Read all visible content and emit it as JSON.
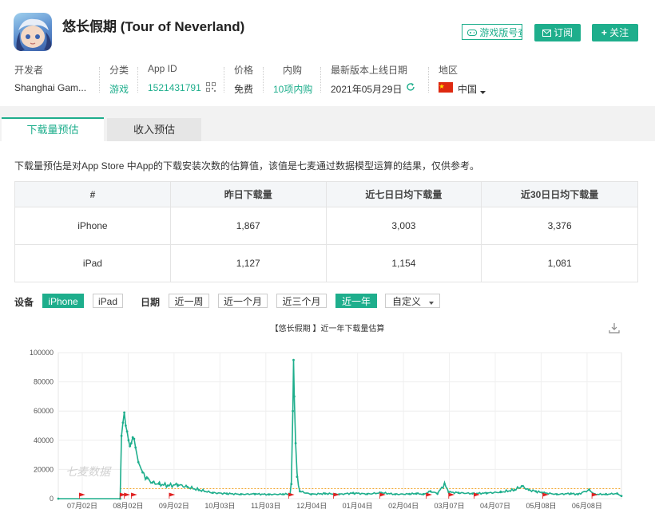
{
  "app": {
    "title": "悠长假期 (Tour of Neverland)",
    "query_button": "游戏版号查询",
    "subscribe_button": "订阅",
    "follow_button": "关注"
  },
  "info": [
    {
      "label": "开发者",
      "value": "Shanghai Gam..."
    },
    {
      "label": "分类",
      "value": "游戏"
    },
    {
      "label": "App ID",
      "value": "1521431791"
    },
    {
      "label": "价格",
      "value": "免费"
    },
    {
      "label": "内购",
      "value": "10项内购"
    },
    {
      "label": "最新版本上线日期",
      "value": "2021年05月29日"
    },
    {
      "label": "地区",
      "value": "中国"
    }
  ],
  "tabs": [
    {
      "label": "下载量预估",
      "active": true
    },
    {
      "label": "收入预估",
      "active": false
    }
  ],
  "description": "下载量预估是对App Store 中App的下载安装次数的估算值，该值是七麦通过数据模型运算的结果，仅供参考。",
  "table": {
    "headers": [
      "#",
      "昨日下载量",
      "近七日日均下载量",
      "近30日日均下载量"
    ],
    "rows": [
      [
        "iPhone",
        "1,867",
        "3,003",
        "3,376"
      ],
      [
        "iPad",
        "1,127",
        "1,154",
        "1,081"
      ]
    ]
  },
  "filters": {
    "device_label": "设备",
    "devices": [
      {
        "label": "iPhone",
        "active": true
      },
      {
        "label": "iPad",
        "active": false
      }
    ],
    "date_label": "日期",
    "ranges": [
      {
        "label": "近一周",
        "active": false
      },
      {
        "label": "近一个月",
        "active": false
      },
      {
        "label": "近三个月",
        "active": false
      },
      {
        "label": "近一年",
        "active": true
      },
      {
        "label": "自定义",
        "active": false
      }
    ]
  },
  "colors": {
    "accent": "#1eae8c",
    "marker": "#e02020",
    "avg_line": "#f0a020"
  },
  "chart_data": {
    "type": "line",
    "title": "【悠长假期 】近一年下载量估算",
    "watermark": "七麦数据",
    "ylim": [
      0,
      100000
    ],
    "yticks": [
      0,
      20000,
      40000,
      60000,
      80000,
      100000
    ],
    "xticks": [
      "07月02日",
      "08月02日",
      "09月02日",
      "10月03日",
      "11月03日",
      "12月04日",
      "01月04日",
      "02月04日",
      "03月07日",
      "04月07日",
      "05月08日",
      "06月08日"
    ],
    "average": 6800,
    "series": [
      {
        "name": "",
        "points": [
          [
            0,
            0
          ],
          [
            44,
            0
          ],
          [
            45,
            43000
          ],
          [
            46,
            52000
          ],
          [
            47,
            59000
          ],
          [
            48,
            50000
          ],
          [
            49,
            46000
          ],
          [
            50,
            40000
          ],
          [
            51,
            36000
          ],
          [
            52,
            38000
          ],
          [
            53,
            42000
          ],
          [
            54,
            41000
          ],
          [
            55,
            35000
          ],
          [
            57,
            25000
          ],
          [
            60,
            18000
          ],
          [
            63,
            14000
          ],
          [
            67,
            11000
          ],
          [
            72,
            10000
          ],
          [
            78,
            9000
          ],
          [
            85,
            9500
          ],
          [
            92,
            8000
          ],
          [
            100,
            6000
          ],
          [
            110,
            4000
          ],
          [
            120,
            3500
          ],
          [
            130,
            3000
          ],
          [
            140,
            3200
          ],
          [
            150,
            2900
          ],
          [
            160,
            3000
          ],
          [
            165,
            3200
          ],
          [
            166,
            10000
          ],
          [
            167,
            60000
          ],
          [
            167.5,
            95000
          ],
          [
            168,
            70000
          ],
          [
            169,
            38000
          ],
          [
            170,
            15000
          ],
          [
            172,
            5000
          ],
          [
            180,
            3000
          ],
          [
            190,
            3500
          ],
          [
            200,
            3000
          ],
          [
            210,
            3800
          ],
          [
            220,
            3200
          ],
          [
            230,
            4000
          ],
          [
            240,
            3000
          ],
          [
            250,
            3200
          ],
          [
            255,
            3500
          ],
          [
            260,
            3000
          ],
          [
            265,
            5000
          ],
          [
            270,
            3500
          ],
          [
            275,
            10000
          ],
          [
            278,
            4500
          ],
          [
            285,
            4000
          ],
          [
            295,
            3500
          ],
          [
            305,
            3800
          ],
          [
            315,
            4500
          ],
          [
            325,
            6000
          ],
          [
            330,
            8500
          ],
          [
            335,
            6000
          ],
          [
            340,
            5000
          ],
          [
            345,
            4000
          ],
          [
            355,
            3000
          ],
          [
            365,
            3500
          ],
          [
            370,
            3000
          ],
          [
            378,
            6000
          ],
          [
            382,
            3000
          ],
          [
            390,
            3000
          ],
          [
            398,
            3500
          ],
          [
            401,
            1867
          ]
        ]
      }
    ],
    "marker_days": [
      15,
      44,
      47,
      52,
      79,
      164,
      196,
      229,
      262,
      278,
      296,
      345,
      380
    ]
  }
}
